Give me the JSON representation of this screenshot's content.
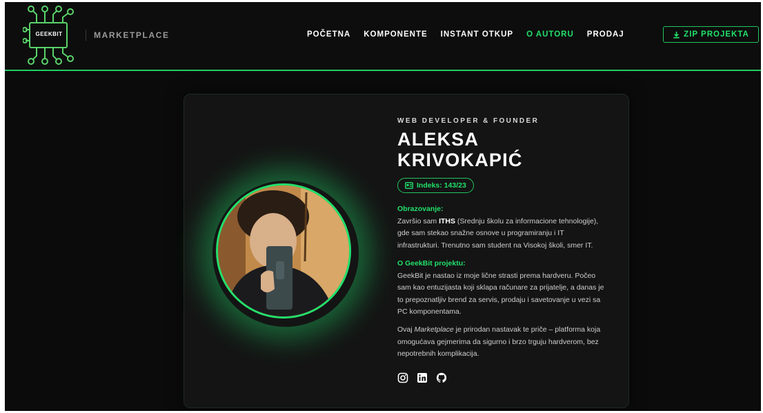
{
  "brand": {
    "logo_text": "GEEKBIT",
    "marketplace_label": "MARKETPLACE"
  },
  "nav": {
    "items": [
      {
        "label": "POČETNA",
        "active": false
      },
      {
        "label": "KOMPONENTE",
        "active": false
      },
      {
        "label": "INSTANT OTKUP",
        "active": false
      },
      {
        "label": "O AUTORU",
        "active": true
      },
      {
        "label": "PRODAJ",
        "active": false
      }
    ],
    "zip_button": {
      "label": "ZIP PROJEKTA",
      "icon": "download-icon"
    }
  },
  "profile": {
    "role": "WEB DEVELOPER & FOUNDER",
    "name_line1": "ALEKSA",
    "name_line2": "KRIVOKAPIĆ",
    "index_badge": "Indeks: 143/23",
    "education": {
      "heading": "Obrazovanje:",
      "text_before": "Završio sam ",
      "text_bold": "ITHS",
      "text_after": " (Srednju školu za informacione tehnologije), gde sam stekao snažne osnove u programiranju i IT infrastrukturi. Trenutno sam student na Visokoj školi, smer IT."
    },
    "project": {
      "heading": "O GeekBit projektu:",
      "text": "GeekBit je nastao iz moje lične strasti prema hardveru. Počeo sam kao entuzijasta koji sklapa računare za prijatelje, a danas je to prepoznatljiv brend za servis, prodaju i savetovanje u vezi sa PC komponentama."
    },
    "marketplace": {
      "text_before": "Ovaj ",
      "text_italic": "Marketplace",
      "text_after": " je prirodan nastavak te priče – platforma koja omogućava gejmerima da sigurno i brzo trguju hardverom, bez nepotrebnih komplikacija."
    },
    "socials": [
      "instagram-icon",
      "linkedin-icon",
      "github-icon"
    ]
  },
  "colors": {
    "accent": "#22e06b",
    "background": "#0b0b0b",
    "card": "#141414"
  }
}
